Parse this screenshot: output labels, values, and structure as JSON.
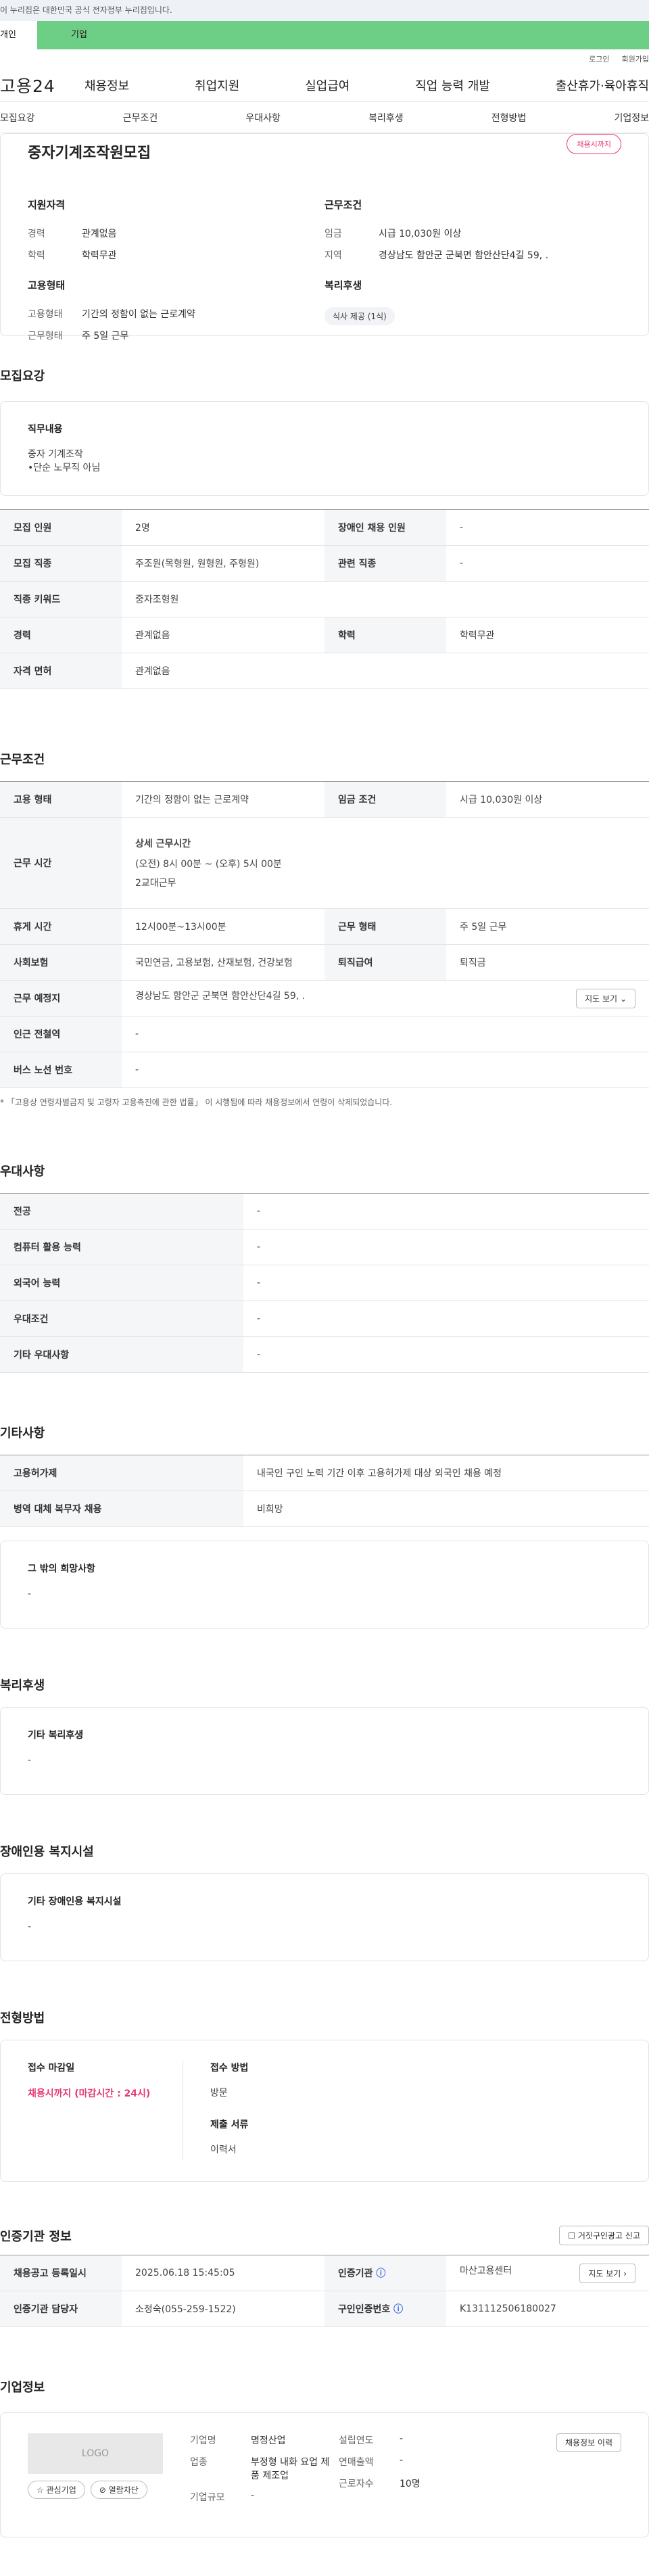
{
  "banner": "이 누리집은 대한민국 공식 전자정부 누리집입니다.",
  "tabs": {
    "person": "개인",
    "corp": "기업"
  },
  "util": {
    "login": "로그인",
    "join": "회원가입"
  },
  "logo": "고용24",
  "gnb": [
    "채용정보",
    "취업지원",
    "실업급여",
    "직업 능력 개발",
    "출산휴가·육아휴직"
  ],
  "subnav": [
    "모집요강",
    "근무조건",
    "우대사항",
    "복리후생",
    "전형방법",
    "기업정보"
  ],
  "title": {
    "job": "중자기계조작원모집",
    "status": "채용시까지"
  },
  "summary": {
    "qual_h": "지원자격",
    "career_k": "경력",
    "career_v": "관계없음",
    "edu_k": "학력",
    "edu_v": "학력무관",
    "emptype_h": "고용형태",
    "emptype_k": "고용형태",
    "emptype_v": "기간의 정함이 없는 근로계약",
    "workform_k": "근무형태",
    "workform_v": "주 5일 근무",
    "cond_h": "근무조건",
    "wage_k": "임금",
    "wage_v": "시급 10,030원 이상",
    "region_k": "지역",
    "region_v": "경상남도 함안군 군북면 함안산단4길 59, .",
    "welfare_h": "복리후생",
    "welfare_chip": "식사 제공 (1식)"
  },
  "recruit": {
    "title": "모집요강",
    "duty_h": "직무내용",
    "duty_lines": [
      "중자 기계조작",
      "•단순 노무직 아님"
    ],
    "rows": [
      {
        "k1": "모집 인원",
        "v1": "2명",
        "k2": "장애인 채용 인원",
        "v2": "-"
      },
      {
        "k1": "모집 직종",
        "v1": "주조원(목형원, 원형원, 주형원)",
        "k2": "관련 직종",
        "v2": "-"
      },
      {
        "k1": "직종 키워드",
        "v1": "중자조형원"
      },
      {
        "k1": "경력",
        "v1": "관계없음",
        "k2": "학력",
        "v2": "학력무관"
      },
      {
        "k1": "자격 면허",
        "v1": "관계없음"
      }
    ]
  },
  "work": {
    "title": "근무조건",
    "r1": {
      "k1": "고용 형태",
      "v1": "기간의 정함이 없는 근로계약",
      "k2": "임금 조건",
      "v2": "시급 10,030원 이상"
    },
    "r2": {
      "k": "근무 시간",
      "sub": "상세 근무시간",
      "l1": "(오전) 8시 00분 ~ (오후) 5시 00분",
      "l2": "2교대근무"
    },
    "r3": {
      "k1": "휴게 시간",
      "v1": "12시00분~13시00분",
      "k2": "근무 형태",
      "v2": "주 5일 근무"
    },
    "r4": {
      "k1": "사회보험",
      "v1": "국민연금, 고용보험, 산재보험, 건강보험",
      "k2": "퇴직급여",
      "v2": "퇴직금"
    },
    "r5": {
      "k": "근무 예정지",
      "v": "경상남도 함안군 군북면 함안산단4길 59, .",
      "btn": "지도 보기"
    },
    "r6": {
      "k": "인근 전철역",
      "v": "-"
    },
    "r7": {
      "k": "버스 노선 번호",
      "v": "-"
    },
    "note": "* 「고용상 연령차별금지 및 고령자 고용촉진에 관한 법률」 이 시행됨에 따라 채용정보에서 연령이 삭제되었습니다."
  },
  "pref": {
    "title": "우대사항",
    "rows": [
      {
        "k": "전공",
        "v": "-"
      },
      {
        "k": "컴퓨터 활용 능력",
        "v": "-"
      },
      {
        "k": "외국어 능력",
        "v": "-"
      },
      {
        "k": "우대조건",
        "v": "-"
      },
      {
        "k": "기타 우대사항",
        "v": "-"
      }
    ]
  },
  "etc": {
    "title": "기타사항",
    "r1": {
      "k": "고용허가제",
      "v": "내국인 구인 노력 기간 이후 고용허가제 대상 외국인 채용 예정"
    },
    "r2": {
      "k": "병역 대체 복무자 채용",
      "v": "비희망"
    },
    "box_h": "그 밖의 희망사항",
    "box_v": "-"
  },
  "welfare": {
    "title": "복리후생",
    "box_h": "기타 복리후생",
    "box_v": "-"
  },
  "disab": {
    "title": "장애인용 복지시설",
    "box_h": "기타 장애인용 복지시설",
    "box_v": "-"
  },
  "screen": {
    "title": "전형방법",
    "deadline_h": "접수 마감일",
    "deadline_v": "채용시까지 (마감시간 : 24시)",
    "method_h": "접수 방법",
    "method_v": "방문",
    "docs_h": "제출 서류",
    "docs_v": "이력서"
  },
  "cert": {
    "title": "인증기관 정보",
    "report_btn": "거짓구인광고 신고",
    "r1": {
      "k1": "채용공고 등록일시",
      "v1": "2025.06.18 15:45:05",
      "k2": "인증기관",
      "v2": "마산고용센터",
      "btn": "지도 보기"
    },
    "r2": {
      "k1": "인증기관 담당자",
      "v1": "소정숙(055-259-1522)",
      "k2": "구인인증번호",
      "v2": "K131112506180027"
    }
  },
  "company": {
    "title": "기업정보",
    "logo": "LOGO",
    "interest_btn": "관심기업",
    "block_btn": "열람차단",
    "name_k": "기업명",
    "name_v": "명정산업",
    "ind_k": "업종",
    "ind_v": "부정형 내화 요업 제품 제조업",
    "size_k": "기업규모",
    "size_v": "-",
    "est_k": "설립연도",
    "est_v": "-",
    "sales_k": "연매출액",
    "sales_v": "-",
    "emp_k": "근로자수",
    "emp_v": "10명",
    "hist_btn": "채용정보 이력"
  }
}
